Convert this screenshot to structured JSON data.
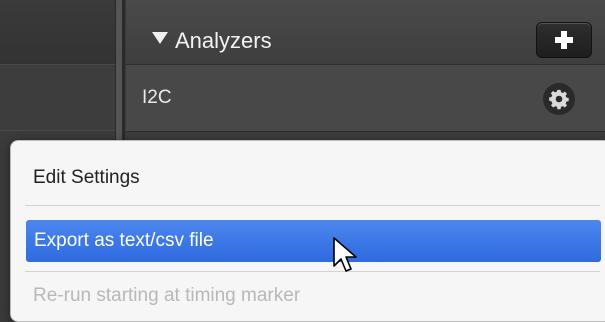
{
  "analyzers_panel": {
    "title": "Analyzers",
    "add_button_icon": "plus-icon",
    "items": [
      {
        "name": "I2C",
        "settings_icon": "gear-icon"
      }
    ]
  },
  "context_menu": {
    "items": [
      {
        "label": "Edit Settings",
        "state": "normal"
      },
      {
        "label": "Export as text/csv file",
        "state": "highlighted"
      },
      {
        "label": "Re-run starting at timing marker",
        "state": "disabled"
      }
    ]
  },
  "colors": {
    "panel_bg": "#3c3c3c",
    "menu_bg": "#f6f6f6",
    "highlight": "#3a76e8"
  }
}
